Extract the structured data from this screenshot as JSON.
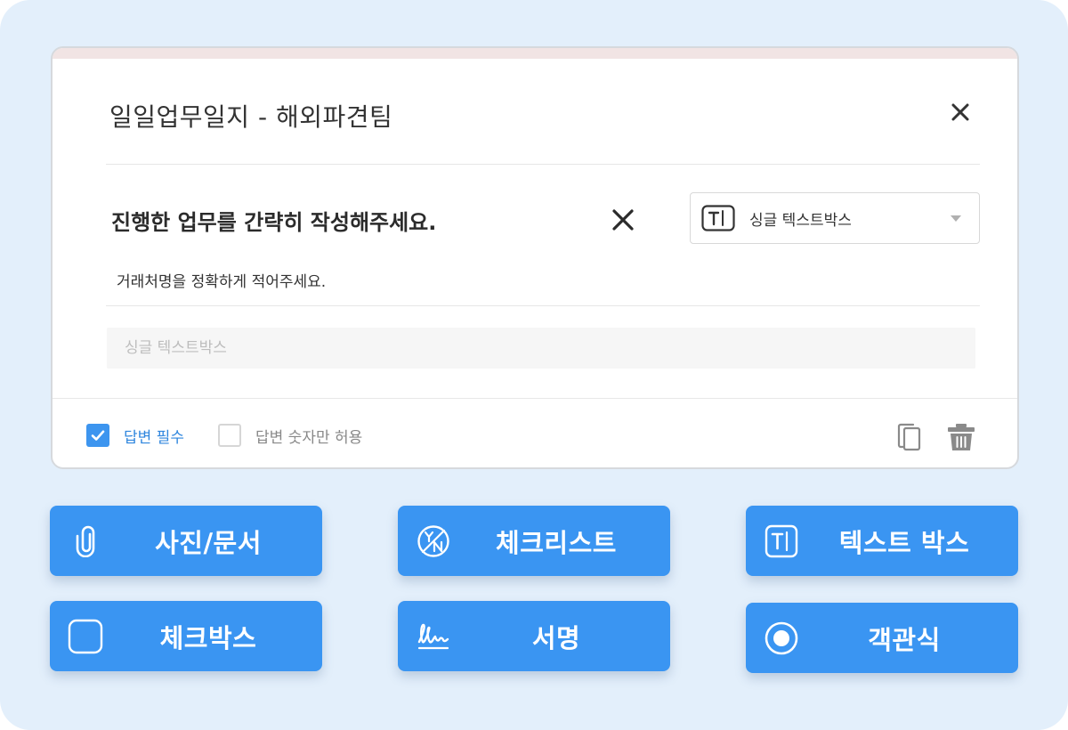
{
  "card": {
    "title": "일일업무일지 - 해외파견팀",
    "question": "진행한 업무를 간략히 작성해주세요.",
    "helper_text": "거래처명을 정확하게 적어주세요.",
    "type_select": {
      "selected": "싱글 텍스트박스",
      "icon": "textbox-icon"
    },
    "answer_placeholder": "싱글 텍스트박스",
    "options": [
      {
        "label": "답변 필수",
        "checked": true
      },
      {
        "label": "답변 숫자만 허용",
        "checked": false
      }
    ]
  },
  "tools": [
    {
      "label": "사진/문서",
      "icon": "paperclip-icon"
    },
    {
      "label": "체크리스트",
      "icon": "yes-no-icon"
    },
    {
      "label": "텍스트 박스",
      "icon": "textbox-icon"
    },
    {
      "label": "체크박스",
      "icon": "checkbox-icon"
    },
    {
      "label": "서명",
      "icon": "signature-icon"
    },
    {
      "label": "객관식",
      "icon": "radio-icon"
    }
  ],
  "colors": {
    "accent": "#3a95f2",
    "background": "#e3effb",
    "checked_text": "#2f86de"
  }
}
